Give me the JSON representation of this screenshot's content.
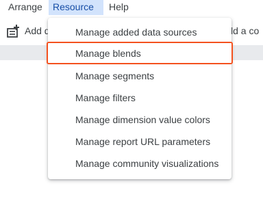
{
  "menubar": {
    "items": [
      {
        "label": "Arrange"
      },
      {
        "label": "Resource"
      },
      {
        "label": "Help"
      }
    ]
  },
  "toolbar": {
    "add_data_label": "Add d",
    "right_partial_label": "ld a co"
  },
  "resource_menu": {
    "items": [
      {
        "label": "Manage added data sources"
      },
      {
        "label": "Manage blends"
      },
      {
        "label": "Manage segments"
      },
      {
        "label": "Manage filters"
      },
      {
        "label": "Manage dimension value colors"
      },
      {
        "label": "Manage report URL parameters"
      },
      {
        "label": "Manage community visualizations"
      }
    ],
    "highlighted_item": "Manage blends"
  },
  "colors": {
    "active_menu_bg": "#d2e3fc",
    "highlight_border": "#f4511e",
    "strip": "#e8eaed"
  }
}
